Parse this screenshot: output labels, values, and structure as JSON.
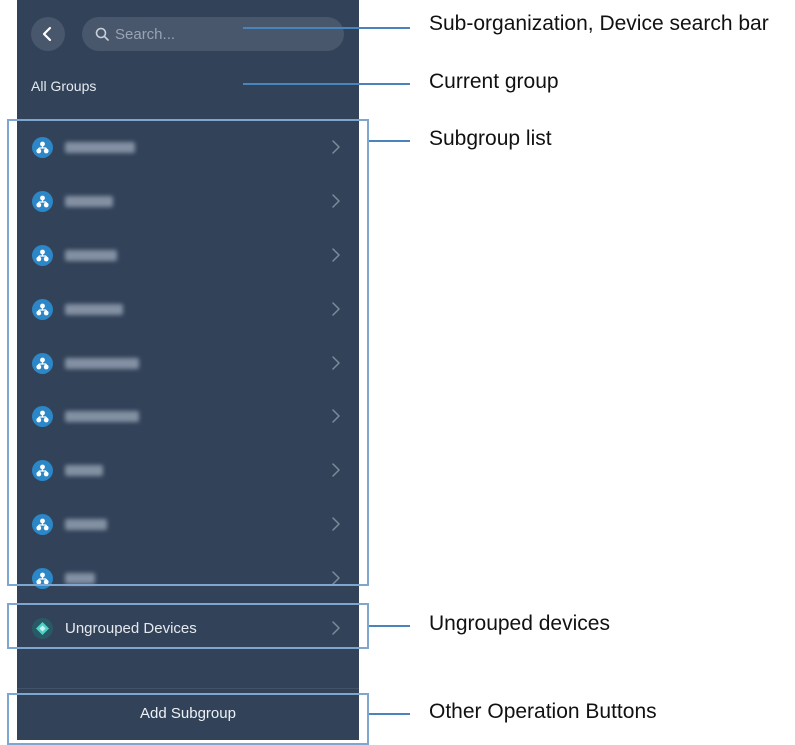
{
  "panel": {
    "search": {
      "placeholder": "Search..."
    },
    "current_group": "All Groups",
    "subgroups": [
      {
        "icon": "group-icon"
      },
      {
        "icon": "group-icon"
      },
      {
        "icon": "group-icon"
      },
      {
        "icon": "group-icon"
      },
      {
        "icon": "group-icon"
      },
      {
        "icon": "group-icon"
      },
      {
        "icon": "group-icon"
      },
      {
        "icon": "group-icon"
      },
      {
        "icon": "group-icon"
      }
    ],
    "ungrouped_label": "Ungrouped Devices",
    "add_subgroup_label": "Add Subgroup"
  },
  "callouts": {
    "search": "Sub-organization, Device search bar",
    "current_group": "Current group",
    "subgroup_list": "Subgroup list",
    "ungrouped": "Ungrouped devices",
    "operations": "Other Operation Buttons"
  },
  "colors": {
    "panel_bg": "#324259",
    "accent": "#2b87c7",
    "callout_line": "#4a84bd"
  }
}
